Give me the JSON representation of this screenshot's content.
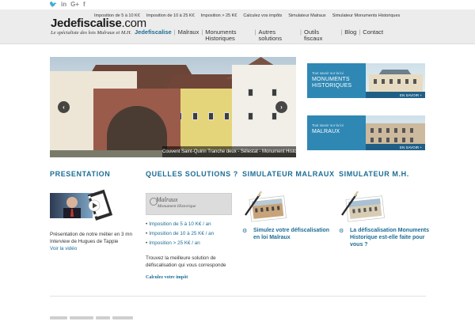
{
  "social": {
    "twitter": "🐦",
    "linkedin": "in",
    "googleplus": "G+",
    "facebook": "f"
  },
  "brand": {
    "logo_prefix": "Jedefiscalise",
    "logo_suffix": ".com",
    "tagline": "Le spécialiste des lois Malraux et M.H."
  },
  "top_links": [
    "Imposition de 5 à 10 K€",
    "Imposition de 10 à 25 K€",
    "Imposition > 25 K€",
    "Calculez vos impôts",
    "Simulateur Malraux",
    "Simulateur Monuments Historiques"
  ],
  "main_nav": [
    "Jedefiscalise",
    "Malraux",
    "Monuments\nHistoriques",
    "Autres\nsolutions",
    "Outils\nfiscaux",
    "Blog",
    "Contact"
  ],
  "slider": {
    "caption": "Couvent Saint-Quirin Tranche deux - Sélestat - Monument Historique",
    "prev": "‹",
    "next": "›"
  },
  "promos": [
    {
      "small": "Tout savoir sur la loi",
      "title": "MONUMENTS\nHISTORIQUES",
      "link": "EN SAVOIR +"
    },
    {
      "small": "Tout savoir sur la loi",
      "title": "MALRAUX",
      "link": "EN SAVOIR +"
    }
  ],
  "columns": {
    "presentation": {
      "title": "PRESENTATION",
      "text": "Présentation de notre métier en 3 mn Interview de Hugues de Tappie",
      "link": "Voir la vidéo"
    },
    "solutions": {
      "title": "QUELLES SOLUTIONS ?",
      "image_title": "Malraux",
      "image_subtitle": "Monument Historique",
      "items": [
        "Imposition de 5 à 10 K€ / an",
        "Imposition de 10 à 25 K€ / an",
        "Imposition > 25 K€ / an"
      ],
      "text": "Trouvez la meilleure solution de défiscalisation qui vous corresponde",
      "link": "Calculez votre impôt"
    },
    "sim_malraux": {
      "title": "SIMULATEUR MALRAUX",
      "cta": "Simulez votre défiscalisation en loi Malraux"
    },
    "sim_mh": {
      "title": "SIMULATEUR M.H.",
      "cta": "La défiscalisation Monuments Historique est-elle faite pour vous ?"
    }
  }
}
